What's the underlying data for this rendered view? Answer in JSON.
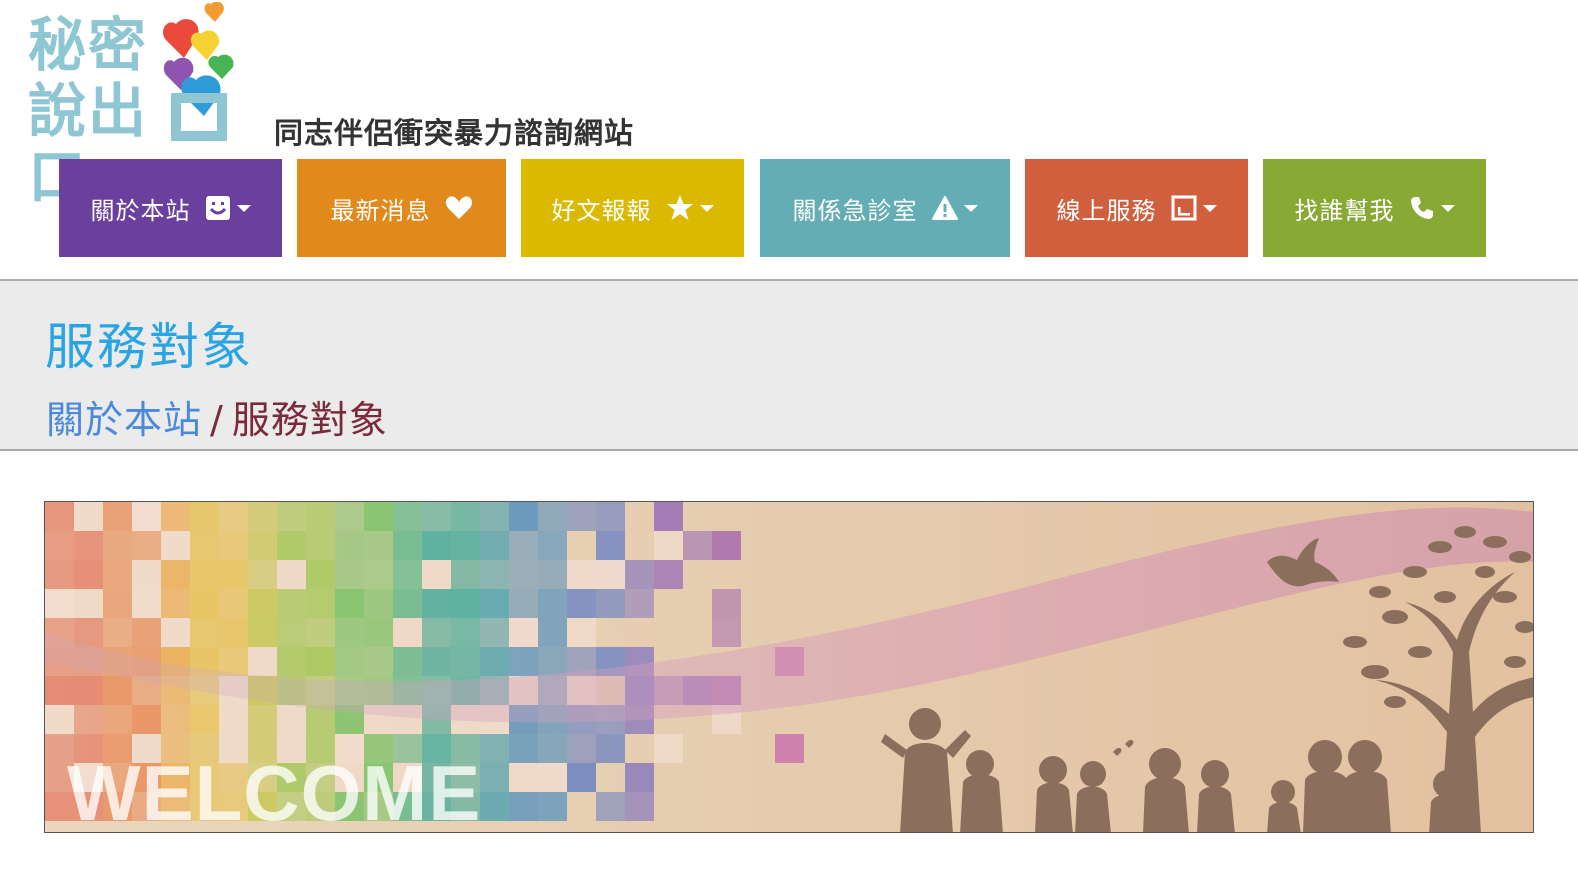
{
  "logo": {
    "line1": "秘密",
    "line2": "說出口"
  },
  "site_subtitle": "同志伴侶衝突暴力諮詢網站",
  "nav": [
    {
      "label": "關於本站",
      "icon": "smile-square-icon",
      "dropdown": true,
      "color": "#6a3f9e"
    },
    {
      "label": "最新消息",
      "icon": "heart-icon",
      "dropdown": false,
      "color": "#e2891c"
    },
    {
      "label": "好文報報",
      "icon": "star-icon",
      "dropdown": true,
      "color": "#dbb900"
    },
    {
      "label": "關係急診室",
      "icon": "warning-icon",
      "dropdown": true,
      "color": "#65adb5"
    },
    {
      "label": "線上服務",
      "icon": "chart-square-icon",
      "dropdown": true,
      "color": "#d0603d"
    },
    {
      "label": "找誰幫我",
      "icon": "phone-icon",
      "dropdown": true,
      "color": "#88aa35"
    }
  ],
  "page": {
    "title": "服務對象",
    "breadcrumb": {
      "parent": "關於本站",
      "separator": "/",
      "current": "服務對象"
    }
  },
  "banner": {
    "text": "WELCOME"
  },
  "colors": {
    "title": "#2aa5e3",
    "breadcrumb_link": "#4a89dc",
    "breadcrumb_current": "#7a2a3a",
    "band_bg": "#ebebeb"
  }
}
